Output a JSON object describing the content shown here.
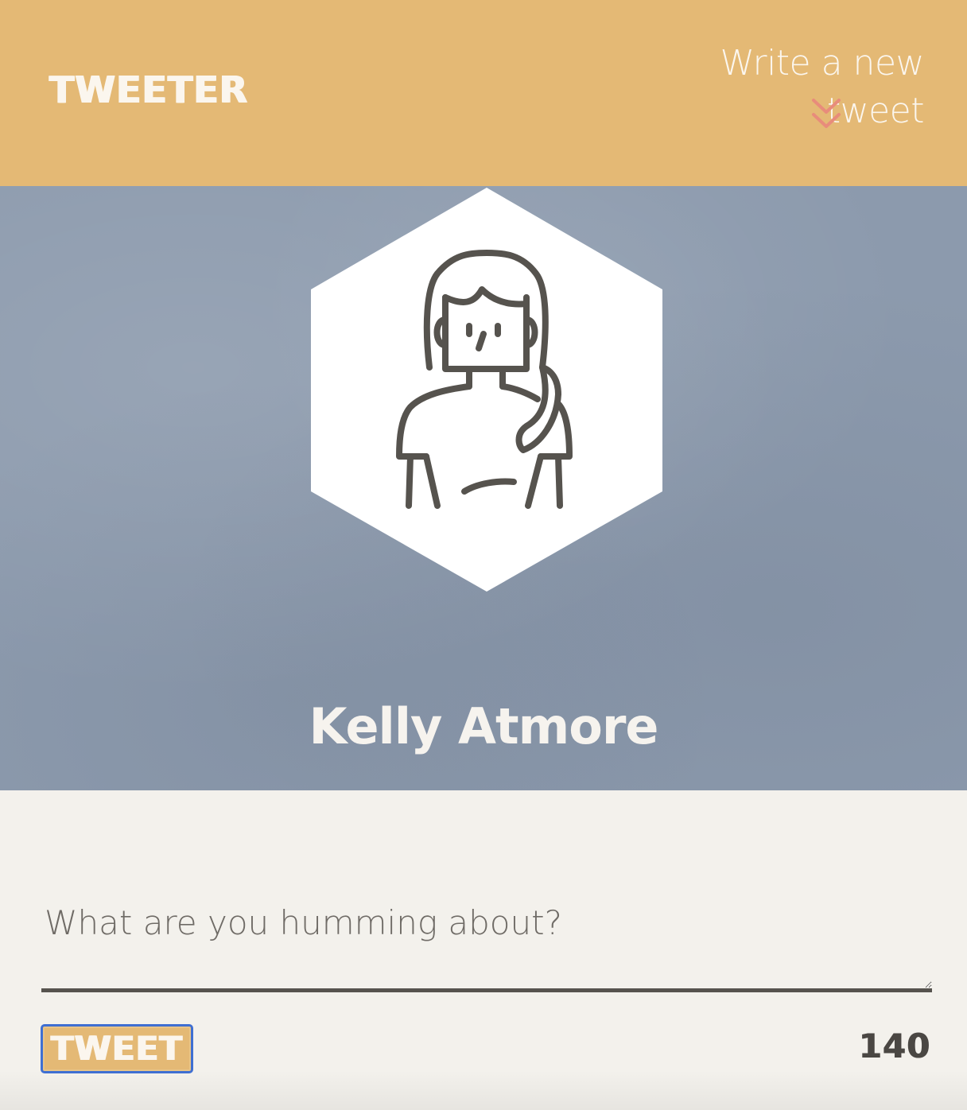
{
  "header": {
    "brand": "TWEETER",
    "compose_toggle_label": "Write a new tweet",
    "compose_toggle_icon": "double-chevron-down-icon"
  },
  "profile": {
    "name": "Kelly Atmore",
    "avatar_icon": "woman-avatar-icon"
  },
  "compose": {
    "placeholder": "What are you humming about?",
    "value": "",
    "submit_label": "TWEET",
    "char_counter": "140"
  },
  "colors": {
    "header_bg": "#e4b975",
    "banner_bg": "#8c9aad",
    "page_bg": "#f3f1ec",
    "chevron": "#e88c7b",
    "text_light": "#fbf6ee",
    "text_dark": "#4a4743",
    "focus_ring": "#3f6fd2"
  }
}
